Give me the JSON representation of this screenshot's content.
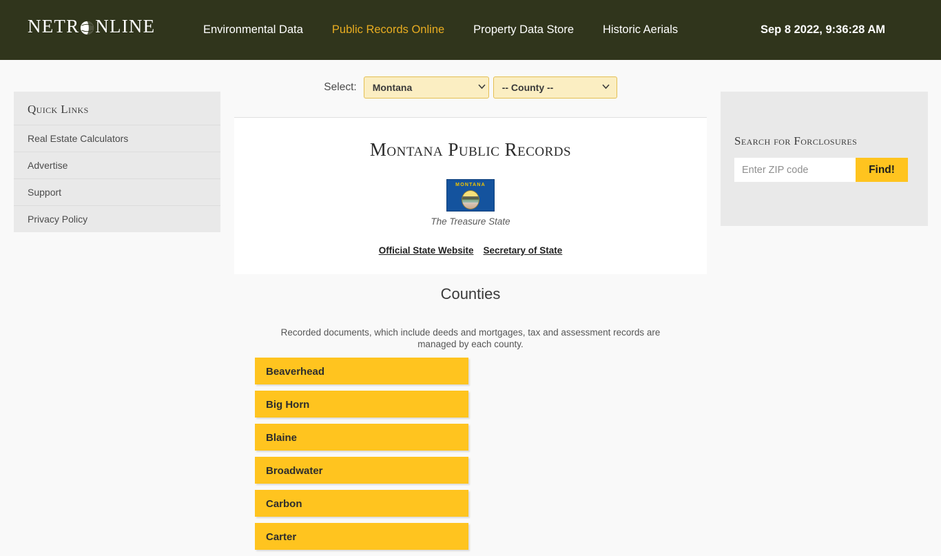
{
  "header": {
    "logo": {
      "before": "NETR",
      "icon": "globe-icon",
      "after": "NLINE"
    },
    "nav": [
      {
        "label": "Environmental Data",
        "active": false
      },
      {
        "label": "Public Records Online",
        "active": true
      },
      {
        "label": "Property Data Store",
        "active": false
      },
      {
        "label": "Historic Aerials",
        "active": false
      }
    ],
    "clock": "Sep 8 2022, 9:36:28 AM",
    "bg_color": "#30351c",
    "active_color": "#e8ac21"
  },
  "sidebar": {
    "title": "Quick Links",
    "items": [
      {
        "label": "Real Estate Calculators"
      },
      {
        "label": "Advertise"
      },
      {
        "label": "Support"
      },
      {
        "label": "Privacy Policy"
      }
    ]
  },
  "select_row": {
    "label": "Select:",
    "state_selected": "Montana",
    "county_selected": "-- County --",
    "state_options": [
      "Montana"
    ],
    "county_options": [
      "-- County --"
    ]
  },
  "main": {
    "title": "Montana Public Records",
    "flag": {
      "alt": "Montana state flag",
      "banner_text": "MONTANA"
    },
    "motto": "The Treasure State",
    "links": [
      {
        "label": "Official State Website"
      },
      {
        "label": "Secretary of State"
      }
    ],
    "counties_heading": "Counties",
    "counties_description": "Recorded documents, which include deeds and mortgages, tax and assessment records are managed by each county.",
    "counties": [
      {
        "name": "Beaverhead"
      },
      {
        "name": "Big Horn"
      },
      {
        "name": "Blaine"
      },
      {
        "name": "Broadwater"
      },
      {
        "name": "Carbon"
      },
      {
        "name": "Carter"
      }
    ],
    "county_button_color": "#ffc41f"
  },
  "right_panel": {
    "title": "Search for Forclosures",
    "zip_placeholder": "Enter ZIP code",
    "zip_value": "",
    "find_label": "Find!"
  }
}
